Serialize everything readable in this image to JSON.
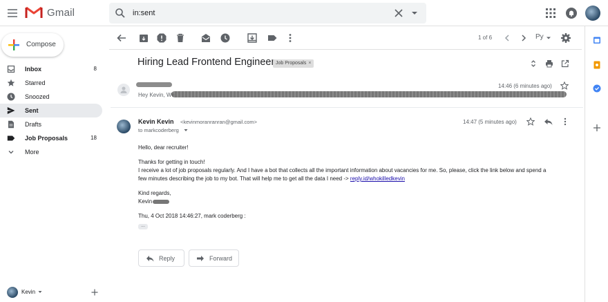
{
  "app": {
    "name": "Gmail"
  },
  "search": {
    "value": "in:sent"
  },
  "compose": {
    "label": "Compose"
  },
  "nav": [
    {
      "label": "Inbox",
      "count": "8",
      "icon": "inbox-icon",
      "bold": true
    },
    {
      "label": "Starred",
      "count": "",
      "icon": "star-icon"
    },
    {
      "label": "Snoozed",
      "count": "",
      "icon": "clock-icon"
    },
    {
      "label": "Sent",
      "count": "",
      "icon": "send-icon",
      "selected": true,
      "bold": true
    },
    {
      "label": "Drafts",
      "count": "",
      "icon": "draft-icon"
    },
    {
      "label": "Job Proposals",
      "count": "18",
      "icon": "label-icon",
      "bold": true
    },
    {
      "label": "More",
      "count": "",
      "icon": "chevron-down-icon"
    }
  ],
  "user": {
    "name": "Kevin"
  },
  "toolbar": {
    "pager": "1 of 6",
    "language": "Ру"
  },
  "thread": {
    "subject": "Hiring Lead Frontend Engineer",
    "label": "Job Proposals"
  },
  "collapsed_message": {
    "snippet": "Hey Kevin, We",
    "time": "14:46 (6 minutes ago)"
  },
  "message": {
    "sender": "Kevin Kevin",
    "email": "<kevinmoranranran@gmail.com>",
    "to": "to markcoderberg",
    "time": "14:47 (5 minutes ago)",
    "greeting": "Hello, dear recruiter!",
    "p1": "Thanks for getting in touch!",
    "p2": "I receive a lot of job proposals regularly. And I have a bot that collects all the important information about vacancies for me. So, please, click the link below and spend a",
    "p3": "few minutes describing the job to my bot. That will help me to get all the data I need ->",
    "link": "reply.id/whokilledkevin",
    "regards": "Kind regards,",
    "signature": "Kevin",
    "quote_header": "Thu, 4 Oct 2018 14:46:27, mark coderberg :",
    "ellipsis": "..."
  },
  "actions": {
    "reply": "Reply",
    "forward": "Forward"
  },
  "colors": {
    "accent_red": "#ea4335",
    "link": "#1a0dab",
    "selected_bg": "#e8eaed"
  }
}
